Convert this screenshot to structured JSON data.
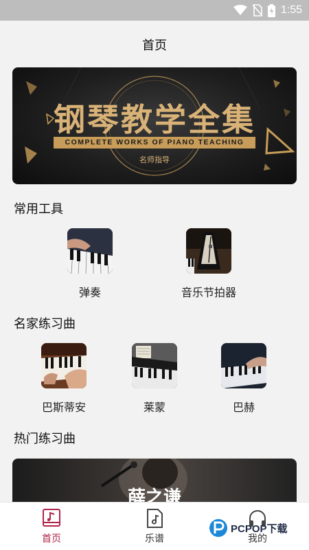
{
  "status_bar": {
    "time": "1:55"
  },
  "header": {
    "title": "首页"
  },
  "banner": {
    "title": "钢琴教学全集",
    "subtitle": "COMPLETE WORKS OF PIANO TEACHING",
    "tag": "名师指导"
  },
  "tools": {
    "title": "常用工具",
    "items": [
      {
        "label": "弹奏",
        "icon": "piano-keys-thumbnail"
      },
      {
        "label": "音乐节拍器",
        "icon": "metronome-thumbnail"
      }
    ]
  },
  "famous": {
    "title": "名家练习曲",
    "items": [
      {
        "label": "巴斯蒂安",
        "icon": "piano-hands-thumbnail"
      },
      {
        "label": "莱蒙",
        "icon": "grand-piano-sheet-thumbnail"
      },
      {
        "label": "巴赫",
        "icon": "piano-dark-thumbnail"
      }
    ]
  },
  "hot": {
    "title": "热门练习曲",
    "card_name": "薛之谦"
  },
  "nav": {
    "items": [
      {
        "label": "首页",
        "icon": "home-score-icon",
        "active": true
      },
      {
        "label": "乐谱",
        "icon": "music-file-icon",
        "active": false
      },
      {
        "label": "我的",
        "icon": "headphones-icon",
        "active": false
      }
    ]
  },
  "watermark": {
    "text": "PCPOP下载"
  },
  "colors": {
    "accent": "#b0244a",
    "gold": "#d9b277",
    "status_bar": "#bdbdbd"
  }
}
